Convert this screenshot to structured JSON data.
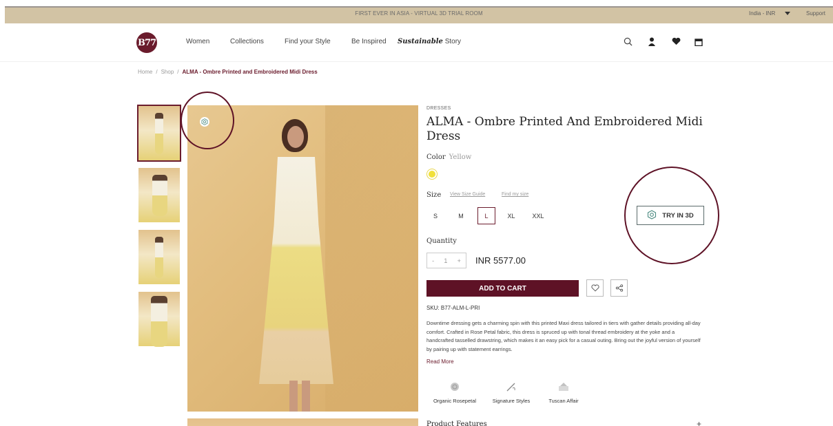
{
  "topbar": {
    "promo": "FIRST EVER IN ASIA - VIRTUAL 3D TRIAL ROOM",
    "region": "India - INR",
    "support": "Support"
  },
  "header": {
    "logo": "B77",
    "nav": [
      "Women",
      "Collections",
      "Find your Style",
      "Be Inspired"
    ],
    "nav_sustainable_bold": "Sustainable",
    "nav_sustainable_rest": " Story",
    "icons": [
      "search-icon",
      "user-icon",
      "heart-icon",
      "bag-icon"
    ]
  },
  "breadcrumb": {
    "home": "Home",
    "shop": "Shop",
    "current": "ALMA - Ombre Printed and Embroidered Midi Dress",
    "sep": "/"
  },
  "product": {
    "category": "DRESSES",
    "title": "ALMA - Ombre Printed And Embroidered Midi Dress",
    "color_label": "Color",
    "color_value": "Yellow",
    "swatch_color": "#f1e03b",
    "size_label": "Size",
    "size_guide": "View Size Guide",
    "find_size": "Find my size",
    "sizes": [
      "S",
      "M",
      "L",
      "XL",
      "XXL"
    ],
    "selected_size": "L",
    "quantity_label": "Quantity",
    "qty_minus": "-",
    "qty_value": "1",
    "qty_plus": "+",
    "price": "INR 5577.00",
    "add_to_cart": "ADD TO CART",
    "try3d": "TRY IN 3D",
    "sku": "SKU: B77-ALM-L-PRI",
    "description": "Downtime dressing gets a charming spin with this printed Maxi dress tailored in tiers with gather details providing all-day comfort. Crafted in Rose Petal fabric, this dress is spruced up with tonal thread embroidery at the yoke and a handcrafted tasselled drawstring, which makes it an easy pick for a casual outing. Bring out the joyful version of yourself by pairing up with statement earrings.",
    "read_more": "Read More",
    "features": [
      "Organic Rosepetal",
      "Signature Styles",
      "Tuscan Affair"
    ],
    "product_features": "Product Features",
    "expand": "+"
  },
  "colors": {
    "brand": "#5e1226",
    "topbar": "#d2c3a4"
  }
}
